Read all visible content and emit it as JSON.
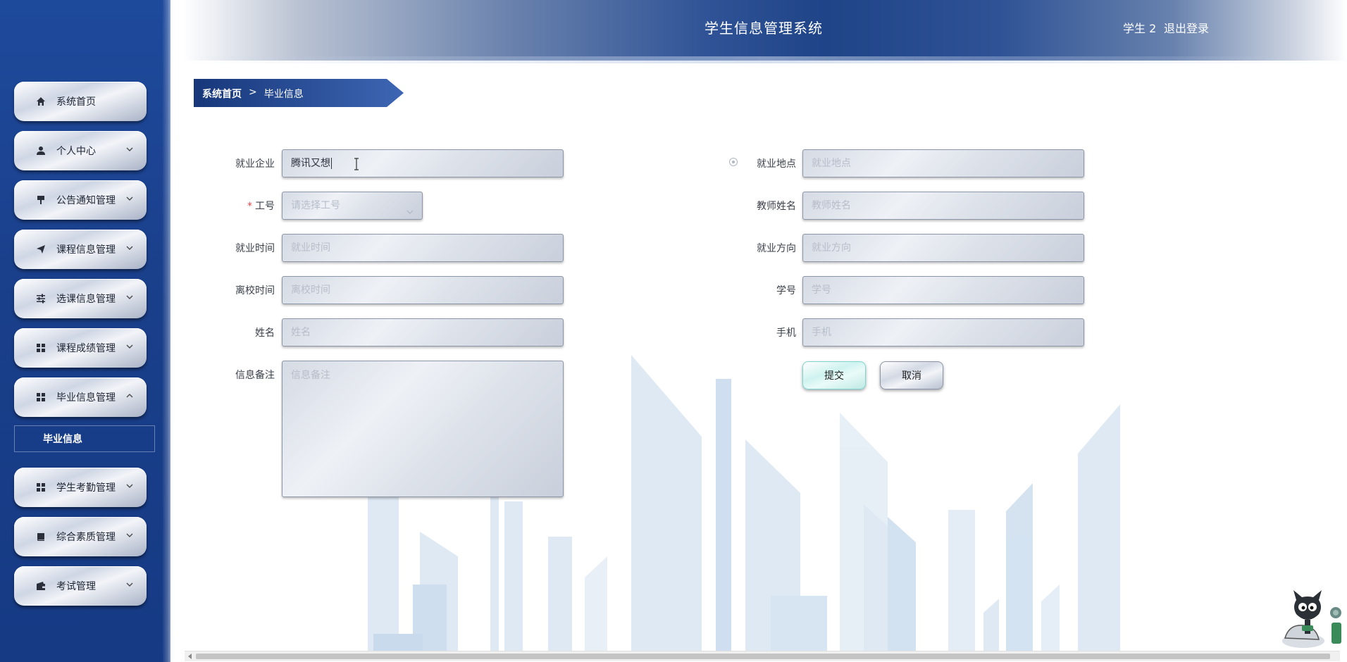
{
  "header": {
    "title": "学生信息管理系统",
    "user": "学生 2",
    "logout": "退出登录"
  },
  "sidebar": {
    "items": [
      {
        "label": "系统首页",
        "icon": "home-icon"
      },
      {
        "label": "个人中心",
        "icon": "user-icon"
      },
      {
        "label": "公告通知管理",
        "icon": "notice-icon"
      },
      {
        "label": "课程信息管理",
        "icon": "send-icon"
      },
      {
        "label": "选课信息管理",
        "icon": "sliders-icon"
      },
      {
        "label": "课程成绩管理",
        "icon": "grid-icon"
      },
      {
        "label": "毕业信息管理",
        "icon": "grid-icon"
      },
      {
        "label": "学生考勤管理",
        "icon": "grid-icon"
      },
      {
        "label": "综合素质管理",
        "icon": "book-icon"
      },
      {
        "label": "考试管理",
        "icon": "wallet-icon"
      }
    ],
    "submenu": {
      "label": "毕业信息"
    }
  },
  "breadcrumb": {
    "home": "系统首页",
    "separator": ">",
    "current": "毕业信息"
  },
  "form": {
    "company": {
      "label": "就业企业",
      "value": "腾讯又想"
    },
    "location": {
      "label": "就业地点",
      "placeholder": "就业地点"
    },
    "employee_no": {
      "label": "工号",
      "placeholder": "请选择工号"
    },
    "teacher": {
      "label": "教师姓名",
      "placeholder": "教师姓名"
    },
    "employ_time": {
      "label": "就业时间",
      "placeholder": "就业时间"
    },
    "direction": {
      "label": "就业方向",
      "placeholder": "就业方向"
    },
    "leave_time": {
      "label": "离校时间",
      "placeholder": "离校时间"
    },
    "student_no": {
      "label": "学号",
      "placeholder": "学号"
    },
    "name": {
      "label": "姓名",
      "placeholder": "姓名"
    },
    "phone": {
      "label": "手机",
      "placeholder": "手机"
    },
    "remark": {
      "label": "信息备注",
      "placeholder": "信息备注"
    },
    "required_mark": "*",
    "submit": "提交",
    "cancel": "取消"
  },
  "colors": {
    "sidebar_bg": "#1a3f8a",
    "header_center": "#1f4487",
    "required": "#e04646"
  }
}
